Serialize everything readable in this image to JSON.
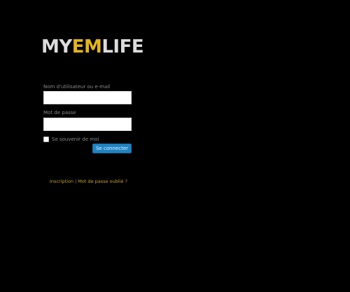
{
  "logo": {
    "part1": "MY",
    "part2": "EM",
    "part3": "LIFE"
  },
  "login_form": {
    "username_label": "Nom d'utilisateur ou e-mail",
    "username_value": "",
    "password_label": "Mot de passe",
    "password_value": "",
    "remember_label": "Se souvenir de moi",
    "submit_label": "Se connecter"
  },
  "footer_links": {
    "register": "Inscription",
    "separator": "|",
    "lost_password": "Mot de passe oublié ?"
  },
  "colors": {
    "background": "#000000",
    "logo_white": "#dcdcdc",
    "logo_accent": "#e3b51b",
    "button": "#1f84c4",
    "link": "#c9a227"
  }
}
